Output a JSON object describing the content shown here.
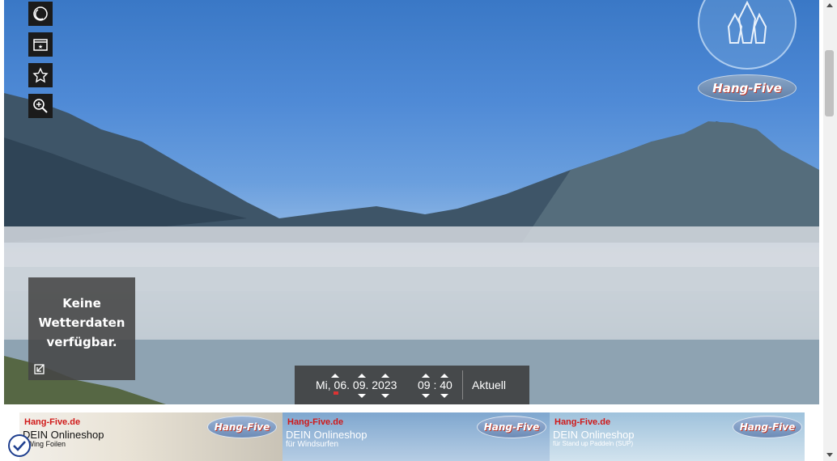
{
  "toolbar": {
    "buttons": [
      {
        "name": "night-mode-button",
        "icon": "moon-clock-icon"
      },
      {
        "name": "gallery-button",
        "icon": "image-star-icon"
      },
      {
        "name": "favorite-button",
        "icon": "star-icon"
      },
      {
        "name": "zoom-button",
        "icon": "zoom-in-icon"
      }
    ]
  },
  "weather": {
    "text": "Keine\nWetterdaten\nverfügbar."
  },
  "datebar": {
    "date": "Mi, 06. 09. 2023",
    "time": "09 : 40",
    "current_label": "Aktuell"
  },
  "logo": {
    "brand": "Hang-Five"
  },
  "banners": [
    {
      "brand": "Hang-Five.de",
      "line2": "DEIN Onlineshop",
      "line3": "r Wing Foilen",
      "logo": "Hang-Five"
    },
    {
      "brand": "Hang-Five.de",
      "line2": "DEIN Onlineshop",
      "line3": "für Windsurfen",
      "logo": "Hang-Five"
    },
    {
      "brand": "Hang-Five.de",
      "line2": "DEIN Onlineshop",
      "line3": "für Stand up Paddeln (SUP)",
      "logo": "Hang-Five"
    }
  ],
  "colors": {
    "sky": "#4f8ad6",
    "overlay": "#3c3c3c",
    "brand_red": "#d01919"
  }
}
